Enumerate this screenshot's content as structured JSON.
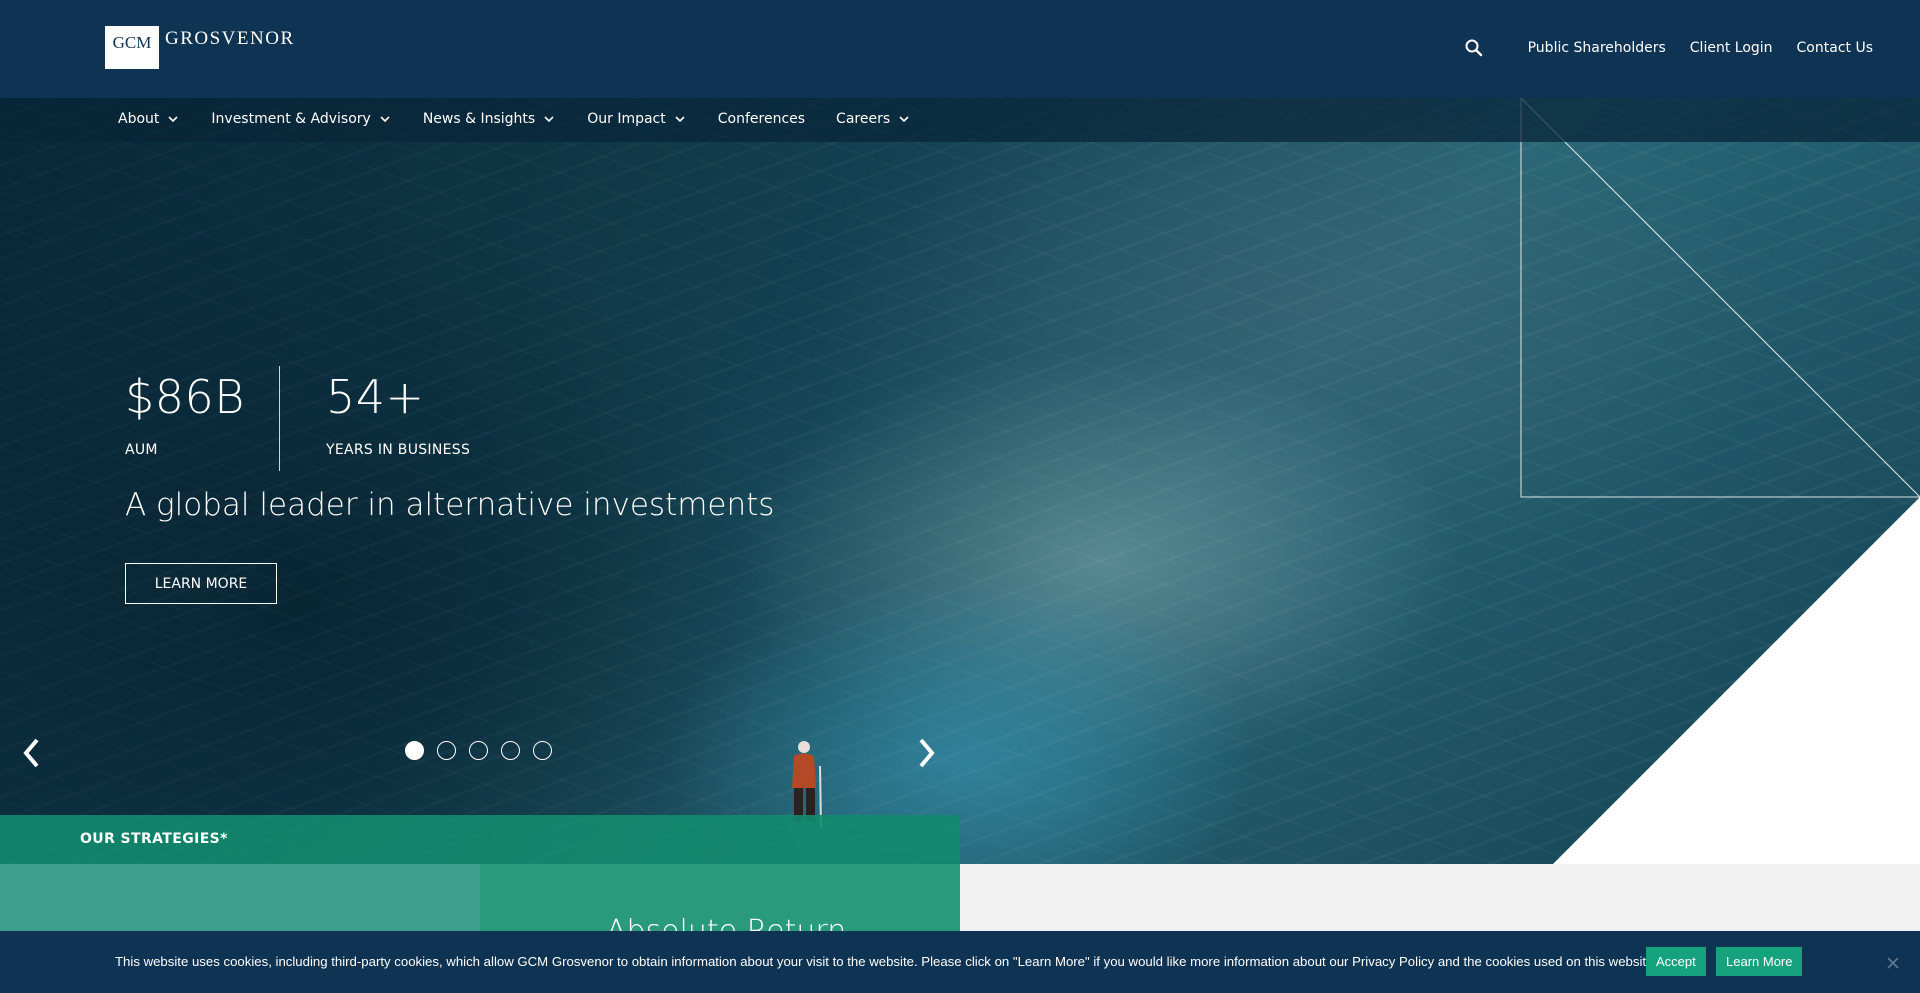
{
  "header": {
    "logo_box": "GCM",
    "logo_word": "GROSVENOR",
    "utility_links": [
      "Public Shareholders",
      "Client Login",
      "Contact Us"
    ]
  },
  "nav": {
    "items": [
      {
        "label": "About",
        "dropdown": true
      },
      {
        "label": "Investment & Advisory",
        "dropdown": true
      },
      {
        "label": "News & Insights",
        "dropdown": true
      },
      {
        "label": "Our Impact",
        "dropdown": true
      },
      {
        "label": "Conferences",
        "dropdown": false
      },
      {
        "label": "Careers",
        "dropdown": true
      }
    ]
  },
  "hero": {
    "stat1_value": "$86B",
    "stat1_label": "AUM",
    "stat2_value": "54+",
    "stat2_label": "YEARS IN BUSINESS",
    "tagline": "A global leader in alternative investments",
    "cta_label": "LEARN MORE",
    "slides": 5,
    "active_slide": 1
  },
  "strategies": {
    "heading": "OUR STRATEGIES*",
    "visible_strategy": "Absolute Return"
  },
  "cookie": {
    "text": "This website uses cookies, including third-party cookies, which allow GCM Grosvenor to obtain information about your visit to the website. Please click on \"Learn More\" if you would like more information about our Privacy Policy and the cookies used on this website.",
    "accept_label": "Accept",
    "learn_label": "Learn More"
  },
  "colors": {
    "navy": "#0f3352",
    "green": "#17a27e",
    "teal_panel": "#2a9a7c"
  },
  "icons": [
    "search-icon",
    "chevron-down-icon",
    "arrow-left-icon",
    "arrow-right-icon",
    "close-icon"
  ]
}
